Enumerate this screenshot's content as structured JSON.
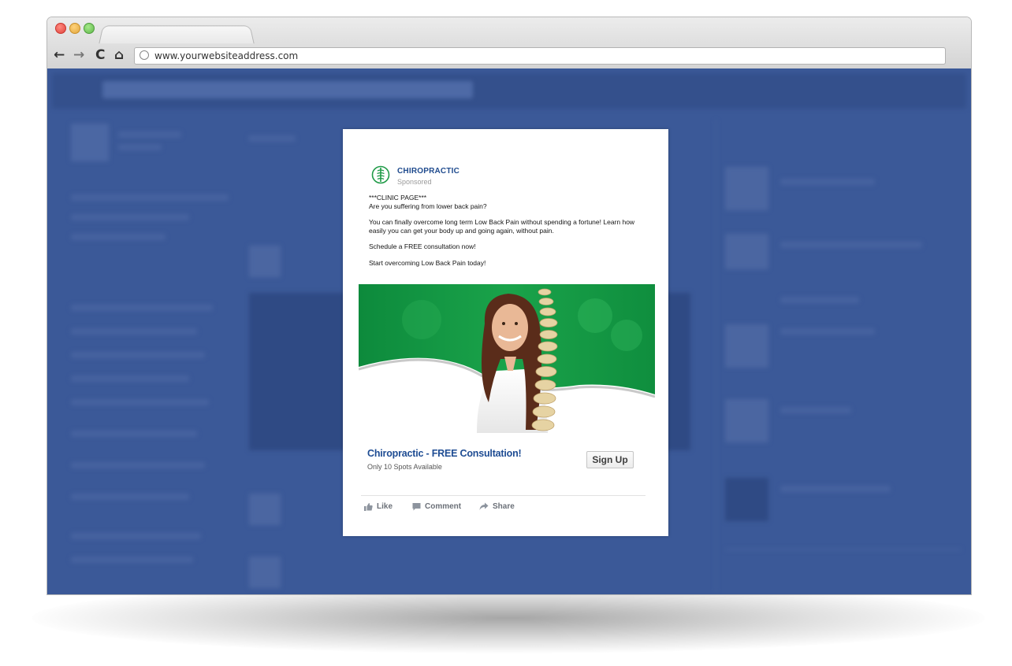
{
  "browser": {
    "url": "www.yourwebsiteaddress.com",
    "nav": {
      "back": "←",
      "forward": "→",
      "reload": "C",
      "home": "⌂"
    }
  },
  "ad": {
    "brand": "CHIROPRACTIC",
    "sponsored": "Sponsored",
    "post_lines": [
      "***CLINIC PAGE***",
      "Are you suffering from lower back pain?",
      "You can finally overcome long term Low Back Pain without spending a fortune! Learn how easily you can get your body up and going again, without pain.",
      "Schedule a FREE consultation now!",
      "Start overcoming Low Back Pain today!"
    ],
    "headline": "Chiropractic - FREE Consultation!",
    "subline": "Only 10 Spots Available",
    "cta": "Sign Up",
    "actions": {
      "like": "Like",
      "comment": "Comment",
      "share": "Share"
    }
  },
  "colors": {
    "facebook_blue": "#3b5998",
    "brand_green": "#1e9a46",
    "headline_blue": "#1e4c93"
  },
  "icons": [
    "globe-icon",
    "back-icon",
    "forward-icon",
    "reload-icon",
    "home-icon",
    "spine-logo-icon",
    "like-icon",
    "comment-icon",
    "share-icon"
  ]
}
